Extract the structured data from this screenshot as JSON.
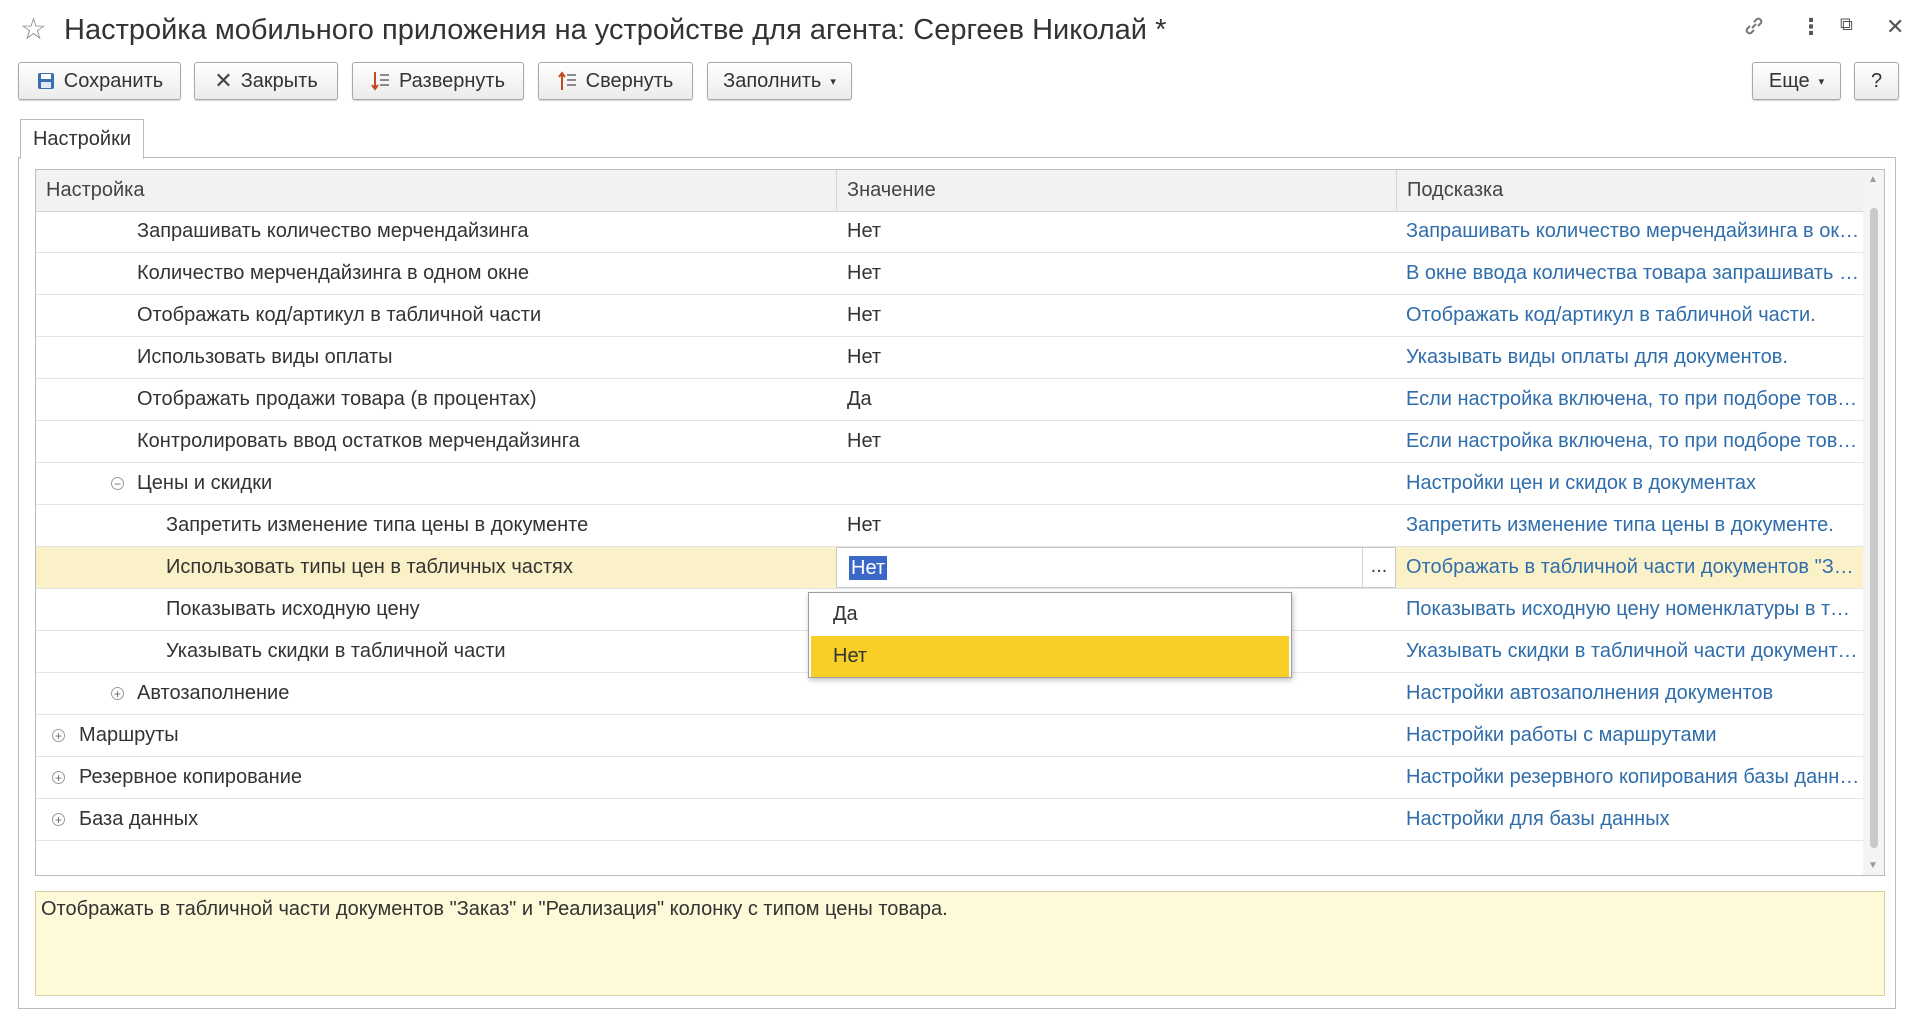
{
  "window": {
    "title": "Настройка мобильного приложения на устройстве для агента: Сергеев Николай *",
    "icons": [
      "star-icon",
      "link-icon",
      "more-icon",
      "restore-icon",
      "close-icon"
    ]
  },
  "toolbar": {
    "save": "Сохранить",
    "close": "Закрыть",
    "expand": "Развернуть",
    "collapse": "Свернуть",
    "fill": "Заполнить",
    "more": "Еще",
    "help": "?"
  },
  "tabs": [
    {
      "label": "Настройки"
    }
  ],
  "grid": {
    "columns": [
      "Настройка",
      "Значение",
      "Подсказка"
    ],
    "rows": [
      {
        "name": "Запрашивать количество мерчендайзинга",
        "value": "Нет",
        "hint": "Запрашивать количество мерчендайзинга в окне..."
      },
      {
        "name": "Количество мерчендайзинга в одном окне",
        "value": "Нет",
        "hint": "В окне ввода количества товара запрашивать к..."
      },
      {
        "name": "Отображать код/артикул в табличной части",
        "value": "Нет",
        "hint": "Отображать код/артикул в табличной части."
      },
      {
        "name": "Использовать виды оплаты",
        "value": "Нет",
        "hint": "Указывать виды оплаты для документов."
      },
      {
        "name": "Отображать продажи товара (в процентах)",
        "value": "Да",
        "hint": "Если настройка включена, то при подборе товар..."
      },
      {
        "name": "Контролировать ввод остатков мерчендайзинга",
        "value": "Нет",
        "hint": "Если настройка включена, то при подборе товар..."
      },
      {
        "name": "Цены и скидки",
        "value": "",
        "hint": "Настройки цен и скидок в документах"
      },
      {
        "name": "Запретить изменение типа цены в документе",
        "value": "Нет",
        "hint": "Запретить изменение типа цены в документе."
      },
      {
        "name": "Использовать типы цен в табличных частях",
        "value": "Нет",
        "hint": "Отображать в табличной части документов \"Зак..."
      },
      {
        "name": "Показывать исходную цену",
        "value": "",
        "hint": "Показывать исходную цену номенклатуры в табл..."
      },
      {
        "name": "Указывать скидки в табличной части",
        "value": "",
        "hint": "Указывать скидки в табличной части документов..."
      },
      {
        "name": "Автозаполнение",
        "value": "",
        "hint": "Настройки автозаполнения документов"
      },
      {
        "name": "Маршруты",
        "value": "",
        "hint": "Настройки работы с маршрутами"
      },
      {
        "name": "Резервное копирование",
        "value": "",
        "hint": "Настройки резервного копирования базы данных..."
      },
      {
        "name": "База данных",
        "value": "",
        "hint": "Настройки для базы данных"
      }
    ]
  },
  "dropdown": {
    "options": [
      "Да",
      "Нет"
    ],
    "highlighted": "Нет"
  },
  "hint_panel": "Отображать в табличной части документов \"Заказ\" и \"Реализация\" колонку с типом цены товара."
}
